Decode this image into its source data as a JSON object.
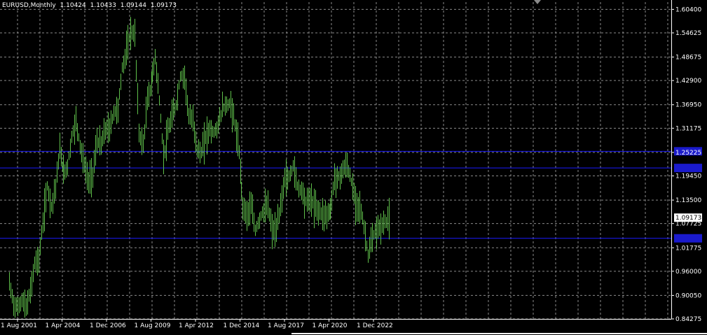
{
  "header": {
    "symbol": "EURUSD,Monthly",
    "open": "1.10424",
    "high": "1.10433",
    "low": "1.09144",
    "close": "1.09173"
  },
  "colors": {
    "background": "#000000",
    "grid": "#8a8a8a",
    "axis": "#ffffff",
    "bars": "#5fbf4a",
    "hline": "#1a1aff",
    "hline_label_bg": "#1a1acc",
    "price_label_bg": "#ffffff",
    "text": "#ffffff"
  },
  "chart_data": {
    "type": "line",
    "title": "EURUSD,Monthly",
    "xlabel": "",
    "ylabel": "",
    "ylim": [
      0.84275,
      1.6219
    ],
    "y_ticks": [
      "1.60400",
      "1.54625",
      "1.48675",
      "1.42900",
      "1.36950",
      "1.31175",
      "1.25225",
      "1.19450",
      "1.13500",
      "1.07725",
      "1.01775",
      "0.96000",
      "0.90050",
      "0.84275"
    ],
    "x_ticks": [
      "1 Aug 2001",
      "1 Apr 2004",
      "1 Dec 2006",
      "1 Aug 2009",
      "1 Apr 2012",
      "1 Dec 2014",
      "1 Aug 2017",
      "1 Apr 2020",
      "1 Dec 2022"
    ],
    "current_price": "1.09173",
    "horizontal_lines": [
      1.255,
      1.214,
      1.041
    ],
    "grid": true,
    "series": [
      {
        "values_by_date": [
          [
            "Feb 2001",
            0.93
          ],
          [
            "May 2001",
            0.88
          ],
          [
            "Aug 2001",
            0.87
          ],
          [
            "Nov 2001",
            0.89
          ],
          [
            "Feb 2002",
            0.87
          ],
          [
            "May 2002",
            0.91
          ],
          [
            "Aug 2002",
            0.98
          ],
          [
            "Nov 2002",
            0.99
          ],
          [
            "Feb 2003",
            1.08
          ],
          [
            "May 2003",
            1.17
          ],
          [
            "Aug 2003",
            1.12
          ],
          [
            "Nov 2003",
            1.17
          ],
          [
            "Feb 2004",
            1.26
          ],
          [
            "May 2004",
            1.2
          ],
          [
            "Aug 2004",
            1.22
          ],
          [
            "Nov 2004",
            1.29
          ],
          [
            "Feb 2005",
            1.33
          ],
          [
            "May 2005",
            1.27
          ],
          [
            "Aug 2005",
            1.22
          ],
          [
            "Nov 2005",
            1.18
          ],
          [
            "Feb 2006",
            1.2
          ],
          [
            "May 2006",
            1.28
          ],
          [
            "Aug 2006",
            1.27
          ],
          [
            "Nov 2006",
            1.31
          ],
          [
            "Feb 2007",
            1.31
          ],
          [
            "May 2007",
            1.35
          ],
          [
            "Aug 2007",
            1.36
          ],
          [
            "Nov 2007",
            1.46
          ],
          [
            "Feb 2008",
            1.5
          ],
          [
            "May 2008",
            1.55
          ],
          [
            "Aug 2008",
            1.54
          ],
          [
            "Nov 2008",
            1.3
          ],
          [
            "Feb 2009",
            1.27
          ],
          [
            "May 2009",
            1.38
          ],
          [
            "Aug 2009",
            1.42
          ],
          [
            "Nov 2009",
            1.49
          ],
          [
            "Feb 2010",
            1.38
          ],
          [
            "May 2010",
            1.24
          ],
          [
            "Aug 2010",
            1.3
          ],
          [
            "Nov 2010",
            1.34
          ],
          [
            "Feb 2011",
            1.37
          ],
          [
            "May 2011",
            1.44
          ],
          [
            "Aug 2011",
            1.44
          ],
          [
            "Nov 2011",
            1.34
          ],
          [
            "Feb 2012",
            1.33
          ],
          [
            "May 2012",
            1.26
          ],
          [
            "Aug 2012",
            1.25
          ],
          [
            "Nov 2012",
            1.29
          ],
          [
            "Feb 2013",
            1.31
          ],
          [
            "May 2013",
            1.3
          ],
          [
            "Aug 2013",
            1.32
          ],
          [
            "Nov 2013",
            1.36
          ],
          [
            "Feb 2014",
            1.37
          ],
          [
            "May 2014",
            1.37
          ],
          [
            "Aug 2014",
            1.32
          ],
          [
            "Nov 2014",
            1.25
          ],
          [
            "Feb 2015",
            1.12
          ],
          [
            "May 2015",
            1.1
          ],
          [
            "Aug 2015",
            1.12
          ],
          [
            "Nov 2015",
            1.06
          ],
          [
            "Feb 2016",
            1.09
          ],
          [
            "May 2016",
            1.11
          ],
          [
            "Aug 2016",
            1.12
          ],
          [
            "Nov 2016",
            1.06
          ],
          [
            "Feb 2017",
            1.06
          ],
          [
            "May 2017",
            1.12
          ],
          [
            "Aug 2017",
            1.19
          ],
          [
            "Nov 2017",
            1.19
          ],
          [
            "Feb 2018",
            1.22
          ],
          [
            "May 2018",
            1.17
          ],
          [
            "Aug 2018",
            1.16
          ],
          [
            "Nov 2018",
            1.13
          ],
          [
            "Feb 2019",
            1.14
          ],
          [
            "May 2019",
            1.12
          ],
          [
            "Aug 2019",
            1.11
          ],
          [
            "Nov 2019",
            1.1
          ],
          [
            "Feb 2020",
            1.1
          ],
          [
            "May 2020",
            1.11
          ],
          [
            "Aug 2020",
            1.19
          ],
          [
            "Nov 2020",
            1.19
          ],
          [
            "Feb 2021",
            1.21
          ],
          [
            "May 2021",
            1.22
          ],
          [
            "Aug 2021",
            1.18
          ],
          [
            "Nov 2021",
            1.13
          ],
          [
            "Feb 2022",
            1.12
          ],
          [
            "May 2022",
            1.07
          ],
          [
            "Aug 2022",
            1.0
          ],
          [
            "Nov 2022",
            1.04
          ],
          [
            "Feb 2023",
            1.06
          ],
          [
            "May 2023",
            1.07
          ],
          [
            "Aug 2023",
            1.08
          ],
          [
            "Nov 2023",
            1.09
          ]
        ]
      }
    ]
  }
}
